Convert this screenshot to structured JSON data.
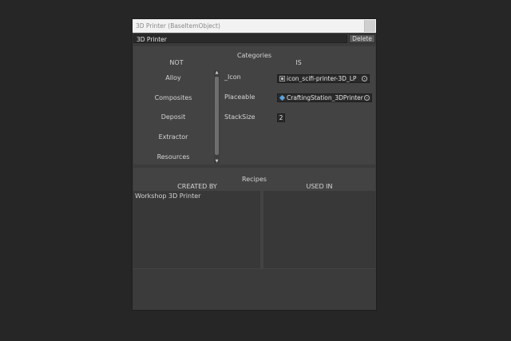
{
  "window": {
    "title": "3D Printer (BaseItemObject)",
    "name_value": "3D Printer",
    "delete_label": "Delete"
  },
  "categories": {
    "header": "Categories",
    "not_label": "NOT",
    "is_label": "IS",
    "items": [
      "Alloy",
      "Composites",
      "Deposit",
      "Extractor",
      "Resources"
    ]
  },
  "properties": [
    {
      "label": "_Icon",
      "value": "icon_scifi-printer-3D_LP",
      "icon": "image-icon"
    },
    {
      "label": "Placeable",
      "value": "CraftingStation_3DPrinter",
      "icon": "prefab-icon"
    },
    {
      "label": "StackSize",
      "value": "2"
    }
  ],
  "recipes": {
    "header": "Recipes",
    "created_by_label": "CREATED BY",
    "used_in_label": "USED IN",
    "created_by_items": [
      "Workshop 3D Printer"
    ],
    "used_in_items": []
  },
  "colors": {
    "background": "#262626",
    "window": "#3b3b3b",
    "titlebar": "#f2f2f2",
    "accent_prefab": "#5aa3d8"
  }
}
